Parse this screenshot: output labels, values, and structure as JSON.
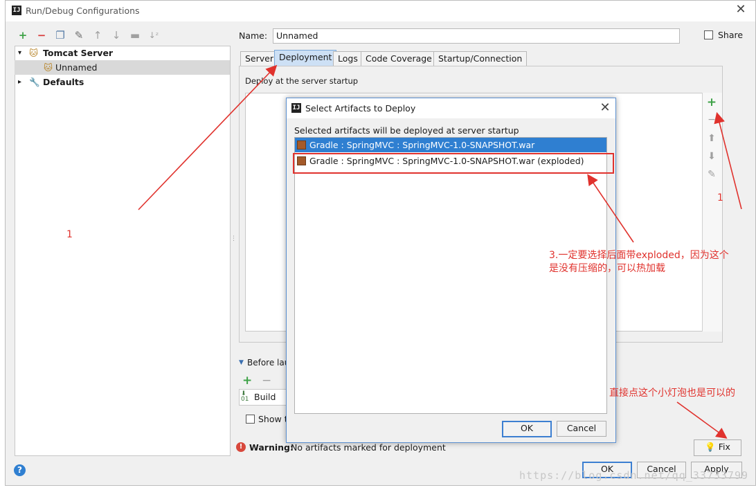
{
  "window": {
    "title": "Run/Debug Configurations",
    "app_icon_label": "IJ"
  },
  "toolbar": {
    "icons": [
      "add-icon",
      "remove-icon",
      "copy-icon",
      "edit-defaults-icon",
      "move-up-icon",
      "move-down-icon",
      "folder-icon",
      "sort-icon"
    ]
  },
  "tree": {
    "items": [
      {
        "label": "Tomcat Server",
        "icon": "tomcat-icon"
      },
      {
        "label": "Unnamed",
        "icon": "tomcat-icon"
      },
      {
        "label": "Defaults",
        "icon": "wrench-icon"
      }
    ]
  },
  "form": {
    "name_label": "Name:",
    "name_value": "Unnamed",
    "share_label": "Share"
  },
  "tabs": [
    "Server",
    "Deployment",
    "Logs",
    "Code Coverage",
    "Startup/Connection"
  ],
  "deployment": {
    "header": "Deploy at the server startup"
  },
  "before_launch": {
    "label": "Before lau",
    "build_item": "Build",
    "show_label": "Show t"
  },
  "warning": {
    "bold": "Warning:",
    "text": "No artifacts marked for deployment",
    "fix_label": "Fix"
  },
  "buttons": {
    "ok": "OK",
    "cancel": "Cancel",
    "apply": "Apply"
  },
  "dialog": {
    "title": "Select Artifacts to Deploy",
    "caption": "Selected artifacts will be deployed at server startup",
    "artifacts": [
      "Gradle : SpringMVC : SpringMVC-1.0-SNAPSHOT.war",
      "Gradle : SpringMVC : SpringMVC-1.0-SNAPSHOT.war (exploded)"
    ],
    "ok": "OK",
    "cancel": "Cancel"
  },
  "annotations": {
    "left_number": "1",
    "right_number": "1",
    "note3_line1": "3.一定要选择后面带exploded，因为这个",
    "note3_line2": "是没有压缩的，可以热加载",
    "fix_note": "直接点这个小灯泡也是可以的"
  },
  "watermark": "https://blog.csdn.net/qq_33733799",
  "colors": {
    "selection": "#2f7fd1",
    "annotation": "#e0322d",
    "add_green": "#3ea247",
    "active_tab": "#cde0f5"
  }
}
